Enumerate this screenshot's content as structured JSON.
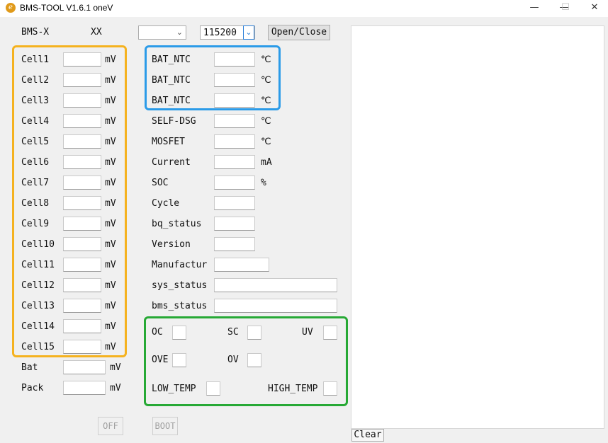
{
  "window": {
    "title": "BMS-TOOL V1.6.1  oneV",
    "app_icon": "e",
    "minimize": "—",
    "maximize": "☐",
    "close": "✕"
  },
  "header": {
    "model": "BMS-X",
    "id": "XX",
    "port": "",
    "baud": "115200",
    "open_close": "Open/Close"
  },
  "cells": [
    {
      "label": "Cell1",
      "unit": "mV"
    },
    {
      "label": "Cell2",
      "unit": "mV"
    },
    {
      "label": "Cell3",
      "unit": "mV"
    },
    {
      "label": "Cell4",
      "unit": "mV"
    },
    {
      "label": "Cell5",
      "unit": "mV"
    },
    {
      "label": "Cell6",
      "unit": "mV"
    },
    {
      "label": "Cell7",
      "unit": "mV"
    },
    {
      "label": "Cell8",
      "unit": "mV"
    },
    {
      "label": "Cell9",
      "unit": "mV"
    },
    {
      "label": "Cell10",
      "unit": "mV"
    },
    {
      "label": "Cell11",
      "unit": "mV"
    },
    {
      "label": "Cell12",
      "unit": "mV"
    },
    {
      "label": "Cell13",
      "unit": "mV"
    },
    {
      "label": "Cell14",
      "unit": "mV"
    },
    {
      "label": "Cell15",
      "unit": "mV"
    }
  ],
  "pack_values": [
    {
      "label": "Bat",
      "unit": "mV"
    },
    {
      "label": "Pack",
      "unit": "mV"
    }
  ],
  "params": [
    {
      "label": "BAT_NTC",
      "unit": "℃"
    },
    {
      "label": "BAT_NTC",
      "unit": "℃"
    },
    {
      "label": "BAT_NTC",
      "unit": "℃"
    },
    {
      "label": "SELF-DSG",
      "unit": "℃"
    },
    {
      "label": "MOSFET",
      "unit": "℃"
    },
    {
      "label": "Current",
      "unit": "mA"
    },
    {
      "label": "SOC",
      "unit": "%"
    },
    {
      "label": "Cycle",
      "unit": ""
    },
    {
      "label": "bq_status",
      "unit": ""
    },
    {
      "label": "Version",
      "unit": ""
    },
    {
      "label": "Manufactur",
      "unit": ""
    },
    {
      "label": "sys_status",
      "unit": ""
    },
    {
      "label": "bms_status",
      "unit": ""
    }
  ],
  "flags": {
    "oc": "OC",
    "sc": "SC",
    "uv": "UV",
    "ove": "OVE",
    "ov": "OV",
    "low_temp": "LOW_TEMP",
    "high_temp": "HIGH_TEMP"
  },
  "buttons": {
    "off": "OFF",
    "boot": "BOOT",
    "clear": "Clear"
  },
  "colors": {
    "cells_frame": "#f5b21f",
    "ntc_frame": "#2b9be8",
    "flags_frame": "#27a935"
  }
}
